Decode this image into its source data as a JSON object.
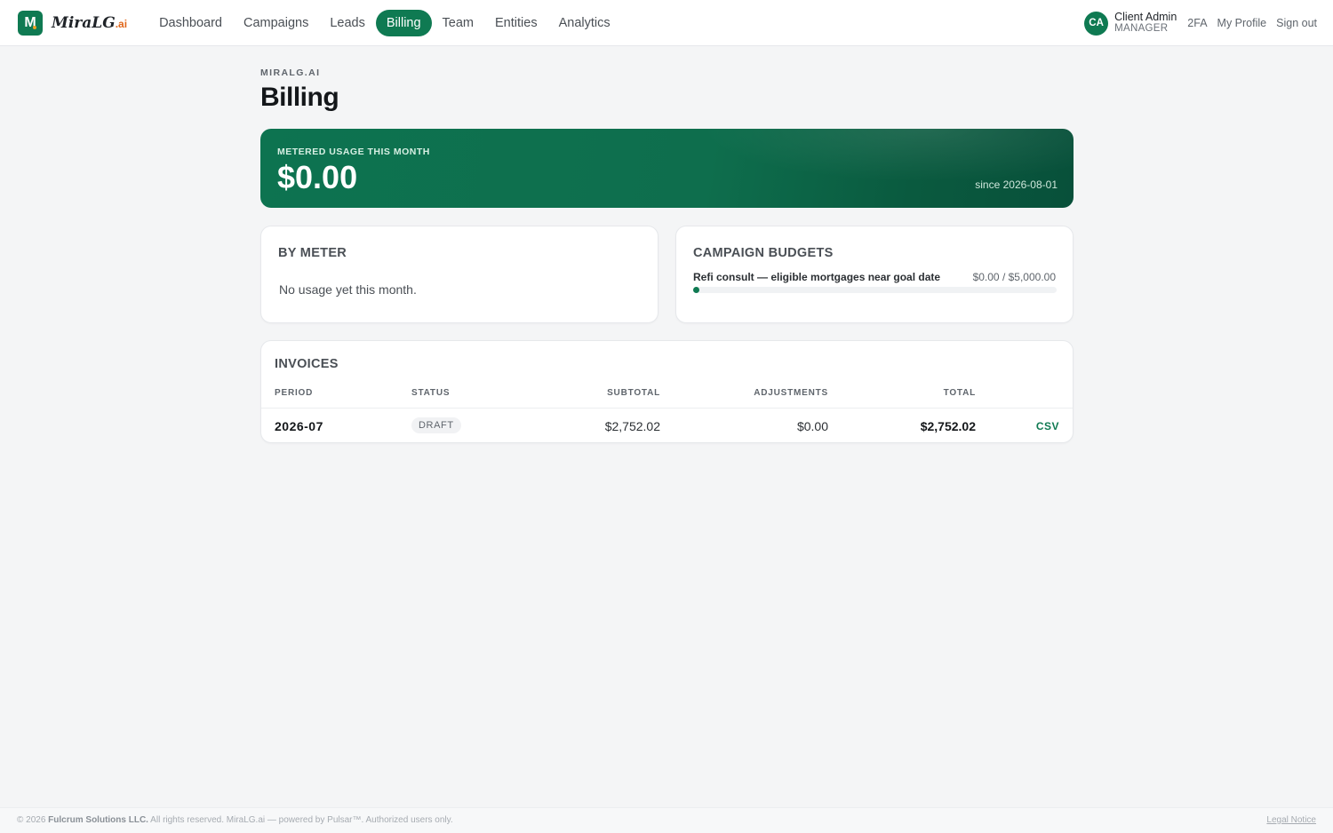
{
  "brand": {
    "badge": "M",
    "name": "MiraLG",
    "suffix": ".ai"
  },
  "nav": {
    "items": [
      {
        "label": "Dashboard"
      },
      {
        "label": "Campaigns"
      },
      {
        "label": "Leads"
      },
      {
        "label": "Billing",
        "active": true
      },
      {
        "label": "Team"
      },
      {
        "label": "Entities"
      },
      {
        "label": "Analytics"
      }
    ]
  },
  "user": {
    "initials": "CA",
    "name": "Client Admin",
    "role": "MANAGER",
    "links": {
      "twofa": "2FA",
      "profile": "My Profile",
      "signout": "Sign out"
    }
  },
  "page": {
    "eyebrow": "MIRALG.AI",
    "title": "Billing"
  },
  "usage": {
    "label": "METERED USAGE THIS MONTH",
    "value": "$0.00",
    "since": "since 2026-08-01"
  },
  "by_meter": {
    "title": "BY METER",
    "empty": "No usage yet this month."
  },
  "budgets": {
    "title": "CAMPAIGN BUDGETS",
    "items": [
      {
        "name": "Refi consult — eligible mortgages near goal date",
        "amount": "$0.00 / $5,000.00",
        "progress": 0
      }
    ]
  },
  "invoices": {
    "title": "INVOICES",
    "columns": {
      "period": "PERIOD",
      "status": "STATUS",
      "subtotal": "SUBTOTAL",
      "adjustments": "ADJUSTMENTS",
      "total": "TOTAL"
    },
    "rows": [
      {
        "period": "2026-07",
        "status": "DRAFT",
        "subtotal": "$2,752.02",
        "adjustments": "$0.00",
        "total": "$2,752.02",
        "action": "CSV"
      }
    ]
  },
  "footer": {
    "copyright_prefix": "© 2026 ",
    "company": "Fulcrum Solutions LLC.",
    "copyright_suffix": " All rights reserved. MiraLG.ai — powered by Pulsar™. Authorized users only.",
    "legal": "Legal Notice"
  },
  "colors": {
    "accent": "#0f7a52",
    "brand_suffix": "#e0661a",
    "background": "#f4f5f6"
  }
}
